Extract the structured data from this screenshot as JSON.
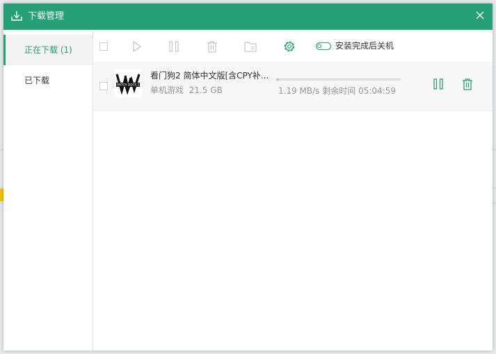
{
  "window": {
    "title": "下载管理"
  },
  "colors": {
    "accent": "#26a077",
    "muted": "#c6c6c6",
    "text_secondary": "#999999"
  },
  "sidebar": {
    "items": [
      {
        "label": "正在下载 (1)",
        "active": true
      },
      {
        "label": "已下载",
        "active": false
      }
    ]
  },
  "toolbar": {
    "icons": [
      "select-all-checkbox",
      "start-icon",
      "pause-icon",
      "delete-icon",
      "open-folder-icon",
      "settings-icon"
    ],
    "shutdown_toggle_label": "安装完成后关机"
  },
  "downloads": [
    {
      "title": "看门狗2  简体中文版[含CPY补...",
      "category": "单机游戏",
      "size": "21.5 GB",
      "speed": "1.19 MB/s",
      "remaining_label": "剩余时间",
      "remaining": "05:04:59",
      "progress": 0.02,
      "thumbnail_text": "WATCH DOGS 2"
    }
  ]
}
